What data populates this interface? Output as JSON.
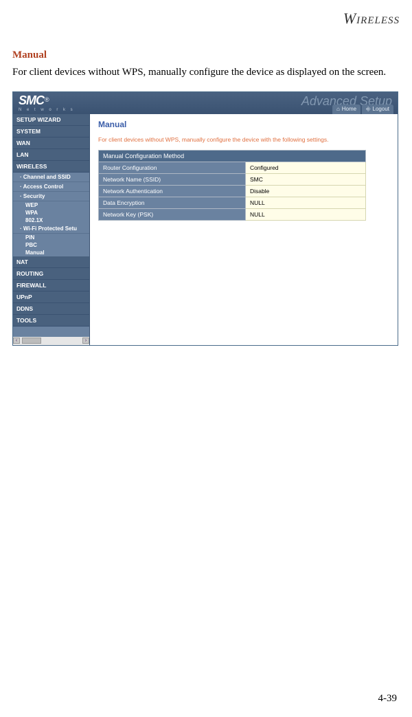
{
  "doc": {
    "header_word": "IRELESS",
    "heading": "Manual",
    "body": "For client devices without WPS, manually configure the device as displayed on the screen.",
    "page_num": "4-39"
  },
  "ui": {
    "brand": "SMC",
    "brand_sub": "N e t w o r k s",
    "adv": "Advanced Setup",
    "home": "Home",
    "logout": "Logout",
    "sidebar": {
      "wizard": "SETUP WIZARD",
      "system": "SYSTEM",
      "wan": "WAN",
      "lan": "LAN",
      "wireless": "WIRELESS",
      "channel": "Channel and SSID",
      "access": "Access Control",
      "security": "Security",
      "wep": "WEP",
      "wpa": "WPA",
      "ieee": "802.1X",
      "wps": "Wi-Fi Protected Setu",
      "pin": "PIN",
      "pbc": "PBC",
      "manual": "Manual",
      "nat": "NAT",
      "routing": "ROUTING",
      "firewall": "FIREWALL",
      "upnp": "UPnP",
      "ddns": "DDNS",
      "tools": "TOOLS"
    },
    "content": {
      "title": "Manual",
      "note": "For client devices without WPS, manually configure the device with the following settings.",
      "table_header": "Manual Configuration Method",
      "rows": [
        {
          "label": "Router Configuration",
          "value": "Configured"
        },
        {
          "label": "Network Name (SSID)",
          "value": "SMC"
        },
        {
          "label": "Network Authentication",
          "value": "Disable"
        },
        {
          "label": "Data Encryption",
          "value": "NULL"
        },
        {
          "label": "Network Key (PSK)",
          "value": "NULL"
        }
      ]
    }
  }
}
